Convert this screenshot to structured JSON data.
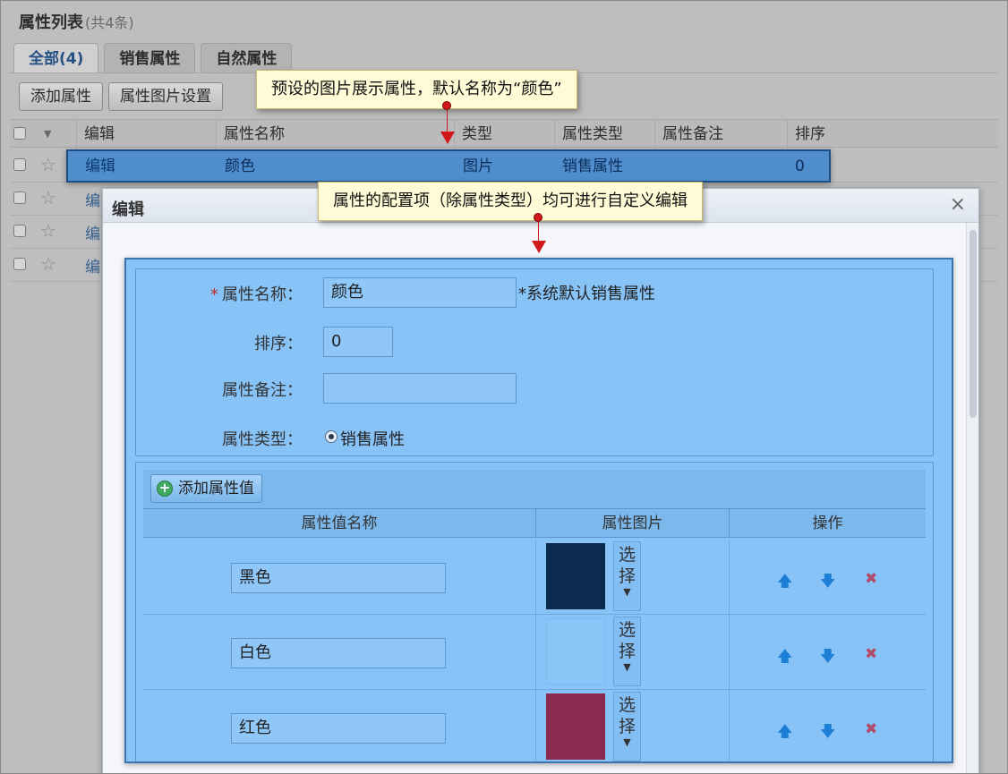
{
  "list": {
    "title": "属性列表",
    "count": "(共4条)"
  },
  "tabs": [
    {
      "label": "全部(4)",
      "active": true
    },
    {
      "label": "销售属性",
      "active": false
    },
    {
      "label": "自然属性",
      "active": false
    }
  ],
  "toolbar": {
    "add_attr": "添加属性",
    "image_settings": "属性图片设置"
  },
  "grid": {
    "columns": [
      "编辑",
      "属性名称",
      "类型",
      "属性类型",
      "属性备注",
      "排序"
    ],
    "highlighted_row": {
      "edit": "编辑",
      "name": "颜色",
      "type": "图片",
      "attr_type": "销售属性",
      "note": "",
      "sort": "0"
    },
    "other_rows_edit": [
      "编",
      "编",
      "编"
    ]
  },
  "callouts": {
    "top": "预设的图片展示属性，默认名称为“颜色”",
    "middle": "属性的配置项（除属性类型）均可进行自定义编辑"
  },
  "dialog": {
    "title": "编辑",
    "close_glyph": "×",
    "form": {
      "required_mark": "*",
      "name_label": "属性名称：",
      "name_value": "颜色",
      "name_note": "*系统默认销售属性",
      "sort_label": "排序：",
      "sort_value": "0",
      "note_label": "属性备注：",
      "note_value": "",
      "type_label": "属性类型：",
      "type_value": "销售属性"
    },
    "values": {
      "add_button": "添加属性值",
      "columns": [
        "属性值名称",
        "属性图片",
        "操作"
      ],
      "choose_label_line1": "选",
      "choose_label_line2": "择",
      "rows": [
        {
          "name": "黑色",
          "swatch": "#0a2a4f"
        },
        {
          "name": "白色",
          "swatch": "#87c3f7"
        },
        {
          "name": "红色",
          "swatch": "#8a2a50"
        }
      ]
    }
  },
  "icons": {
    "star": "star-icon",
    "up": "arrow-up-icon",
    "down": "arrow-down-icon",
    "delete": "delete-icon",
    "plus": "add-circle-icon",
    "sort_caret": "caret-down-icon"
  },
  "colors": {
    "highlight": "#4f8dcc",
    "panel": "#87c3f7",
    "pin": "#d0181a",
    "callout_bg": "#fffbd6"
  }
}
